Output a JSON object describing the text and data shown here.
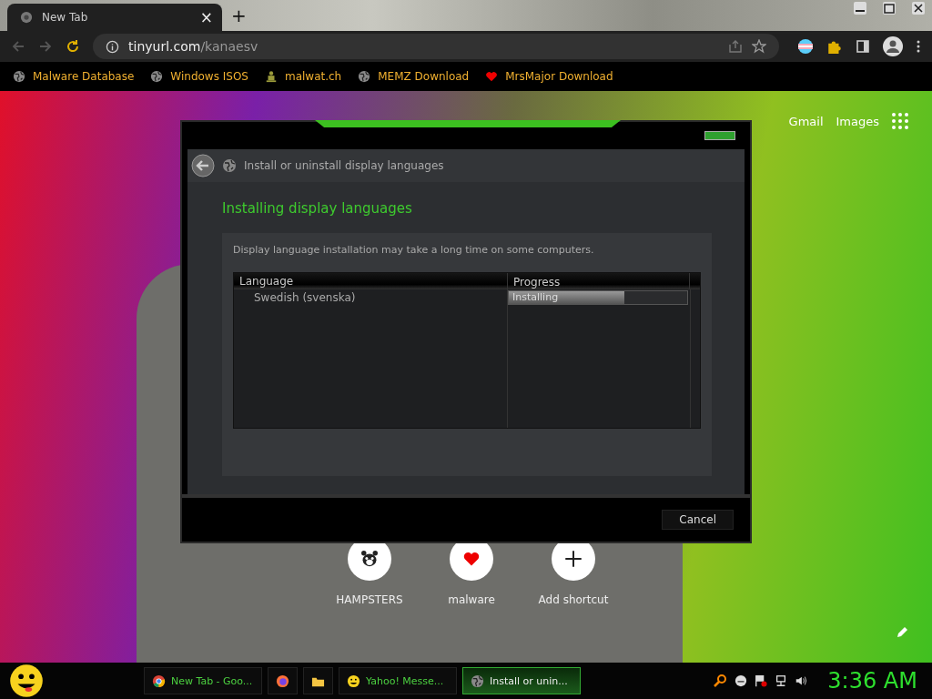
{
  "browser": {
    "tab": {
      "title": "New Tab",
      "close": "×"
    },
    "new_tab": "+",
    "url": {
      "domain": "tinyurl.com",
      "path": "/kanaesv"
    },
    "bookmarks": [
      {
        "label": "Malware Database",
        "kind": "globe"
      },
      {
        "label": "Windows ISOS",
        "kind": "globe"
      },
      {
        "label": "malwat.ch",
        "kind": "figure"
      },
      {
        "label": "MEMZ Download",
        "kind": "globe"
      },
      {
        "label": "MrsMajor Download",
        "kind": "heart"
      }
    ]
  },
  "page": {
    "links": [
      "Gmail",
      "Images"
    ],
    "shortcuts": [
      {
        "label": "HAMPSTERS",
        "kind": "animal"
      },
      {
        "label": "malware",
        "kind": "heart"
      },
      {
        "label": "Add shortcut",
        "kind": "plus"
      }
    ]
  },
  "dialog": {
    "breadcrumb": "Install or uninstall display languages",
    "heading": "Installing display languages",
    "note": "Display language installation may take a long time on some computers.",
    "columns": [
      "Language",
      "Progress"
    ],
    "rows": [
      {
        "language": "Swedish (svenska)",
        "status": "Installing",
        "level": 0.65
      }
    ],
    "buttons": [
      "Cancel"
    ]
  },
  "taskbar": {
    "items": [
      {
        "label": "New Tab - Goo...",
        "kind": "chrome",
        "selected": false
      },
      {
        "kind": "firefox",
        "selected": false
      },
      {
        "kind": "folder",
        "selected": false
      },
      {
        "label": "Yahoo! Messe...",
        "kind": "smiley",
        "selected": false
      },
      {
        "label": "Install or unin...",
        "kind": "globe",
        "selected": true
      }
    ],
    "clock": "3:36 AM"
  }
}
